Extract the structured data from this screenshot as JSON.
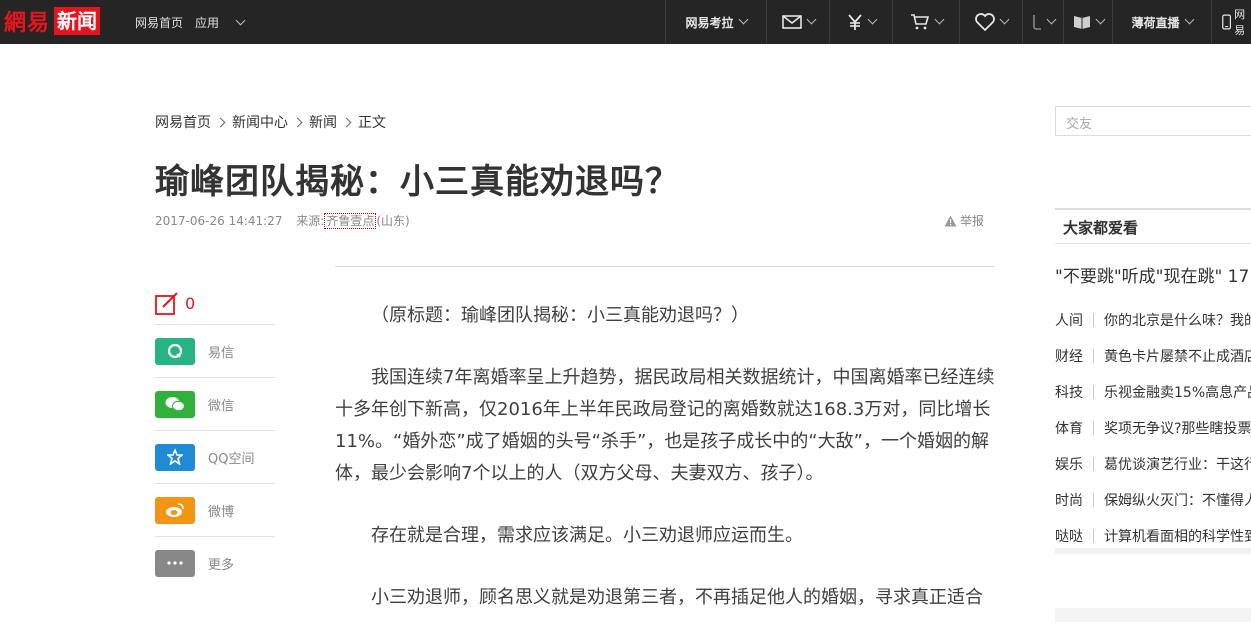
{
  "topbar": {
    "logo_text": "網易",
    "logo_badge": "新闻",
    "nav": [
      "网易首页",
      "应用"
    ],
    "right": {
      "kaola": "网易考拉",
      "live": "薄荷直播",
      "more": "网易"
    }
  },
  "breadcrumb": [
    "网易首页",
    "新闻中心",
    "新闻",
    "正文"
  ],
  "article": {
    "title": "瑜峰团队揭秘：小三真能劝退吗？",
    "datetime": "2017-06-26 14:41:27",
    "source_prefix": "来源:",
    "source_name": "齐鲁壹点",
    "source_suffix": "(山东)",
    "report_label": "举报",
    "paragraphs": [
      "（原标题：瑜峰团队揭秘：小三真能劝退吗？）",
      "我国连续7年离婚率呈上升趋势，据民政局相关数据统计，中国离婚率已经连续十多年创下新高，仅2016年上半年民政局登记的离婚数就达168.3万对，同比增长11%。“婚外恋”成了婚姻的头号“杀手”，也是孩子成长中的“大敌”，一个婚姻的解体，最少会影响7个以上的人（双方父母、夫妻双方、孩子）。",
      "存在就是合理，需求应该满足。小三劝退师应运而生。",
      "小三劝退师，顾名思义就是劝退第三者，不再插足他人的婚姻，寻求真正适合"
    ]
  },
  "share": {
    "comment_count": "0",
    "items": [
      {
        "label": "易信",
        "color": "#27b383"
      },
      {
        "label": "微信",
        "color": "#2fb13a"
      },
      {
        "label": "QQ空间",
        "color": "#1f8bd6"
      },
      {
        "label": "微博",
        "color": "#f29515"
      },
      {
        "label": "更多",
        "color": "#888888"
      }
    ]
  },
  "sidebar": {
    "search_placeholder": "交友",
    "box_title": "大家都爱看",
    "headline": "\"不要跳\"听成\"现在跳\" 17",
    "list": [
      {
        "cat": "人间",
        "text": "你的北京是什么味？我的"
      },
      {
        "cat": "财经",
        "text": "黄色卡片屡禁不止成酒店"
      },
      {
        "cat": "科技",
        "text": "乐视金融卖15%高息产品"
      },
      {
        "cat": "体育",
        "text": "奖项无争议?那些瞎投票"
      },
      {
        "cat": "娱乐",
        "text": "葛优谈演艺行业：干这行"
      },
      {
        "cat": "时尚",
        "text": "保姆纵火灭门：不懂得人"
      },
      {
        "cat": "哒哒",
        "text": "计算机看面相的科学性到"
      }
    ]
  }
}
